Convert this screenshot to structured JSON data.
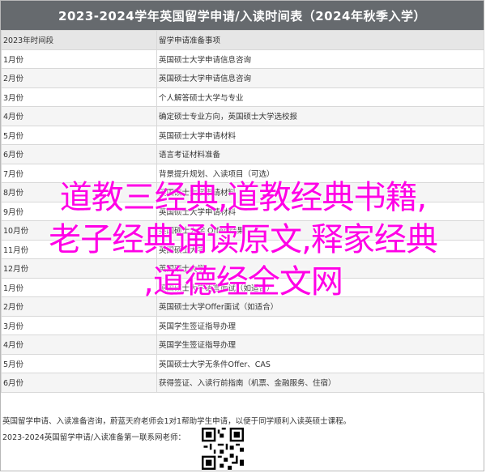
{
  "title": "2023-2024学年英国留学申请/入读时间表（2024年秋季入学）",
  "table": {
    "headers": [
      "2023年时间段",
      "留学申请准备事项"
    ],
    "rows": [
      [
        "1月份",
        "英国硕士大学申请信息咨询"
      ],
      [
        "2月份",
        "英国硕士大学申请信息咨询"
      ],
      [
        "3月份",
        "个人解答硕士大学与专业"
      ],
      [
        "4月份",
        "确定硕士专业方向，英国硕士大学选校报"
      ],
      [
        "5月份",
        "英国硕士大学申请材料"
      ],
      [
        "6月份",
        "语言考证材料准备"
      ],
      [
        "7月份",
        "背景提升规划、入读项目（可选）"
      ],
      [
        "8月份",
        "英国硕士大学申请材料"
      ],
      [
        "9月份",
        "英国硕士大学申请材料"
      ],
      [
        "10月份",
        "英国硕士大学 Offer 结果"
      ],
      [
        "11月份",
        "英国硕士大学"
      ],
      [
        "12月份",
        "英国硕士大学"
      ],
      [
        "1月份",
        "英国硕士大学语言面试（如适合）"
      ],
      [
        "2月份",
        "英国硕士大学Offer面试（如适合）"
      ],
      [
        "3月份",
        "英国学生签证指导办理"
      ],
      [
        "4月份",
        "英国学生签证指导办理"
      ],
      [
        "5月份",
        "英国硕士大学无条件Offer、CAS"
      ],
      [
        "6月份",
        "获得签证、入读行前指南（机票、金融服务、住宿）"
      ]
    ]
  },
  "footer": {
    "line1": "英国留学申请、入读准备咨询，蔚蓝天府老师会1对1帮助学生申请，以便于同学顺利入读英硕士课程。",
    "line2": "2023-2024英国留学申请/入读准备第一联系网老师："
  },
  "overlay": {
    "lines": [
      "道教三经典,道教经典书籍,",
      "老子经典诵读原文,释家经典",
      ",道德经全文网"
    ]
  }
}
